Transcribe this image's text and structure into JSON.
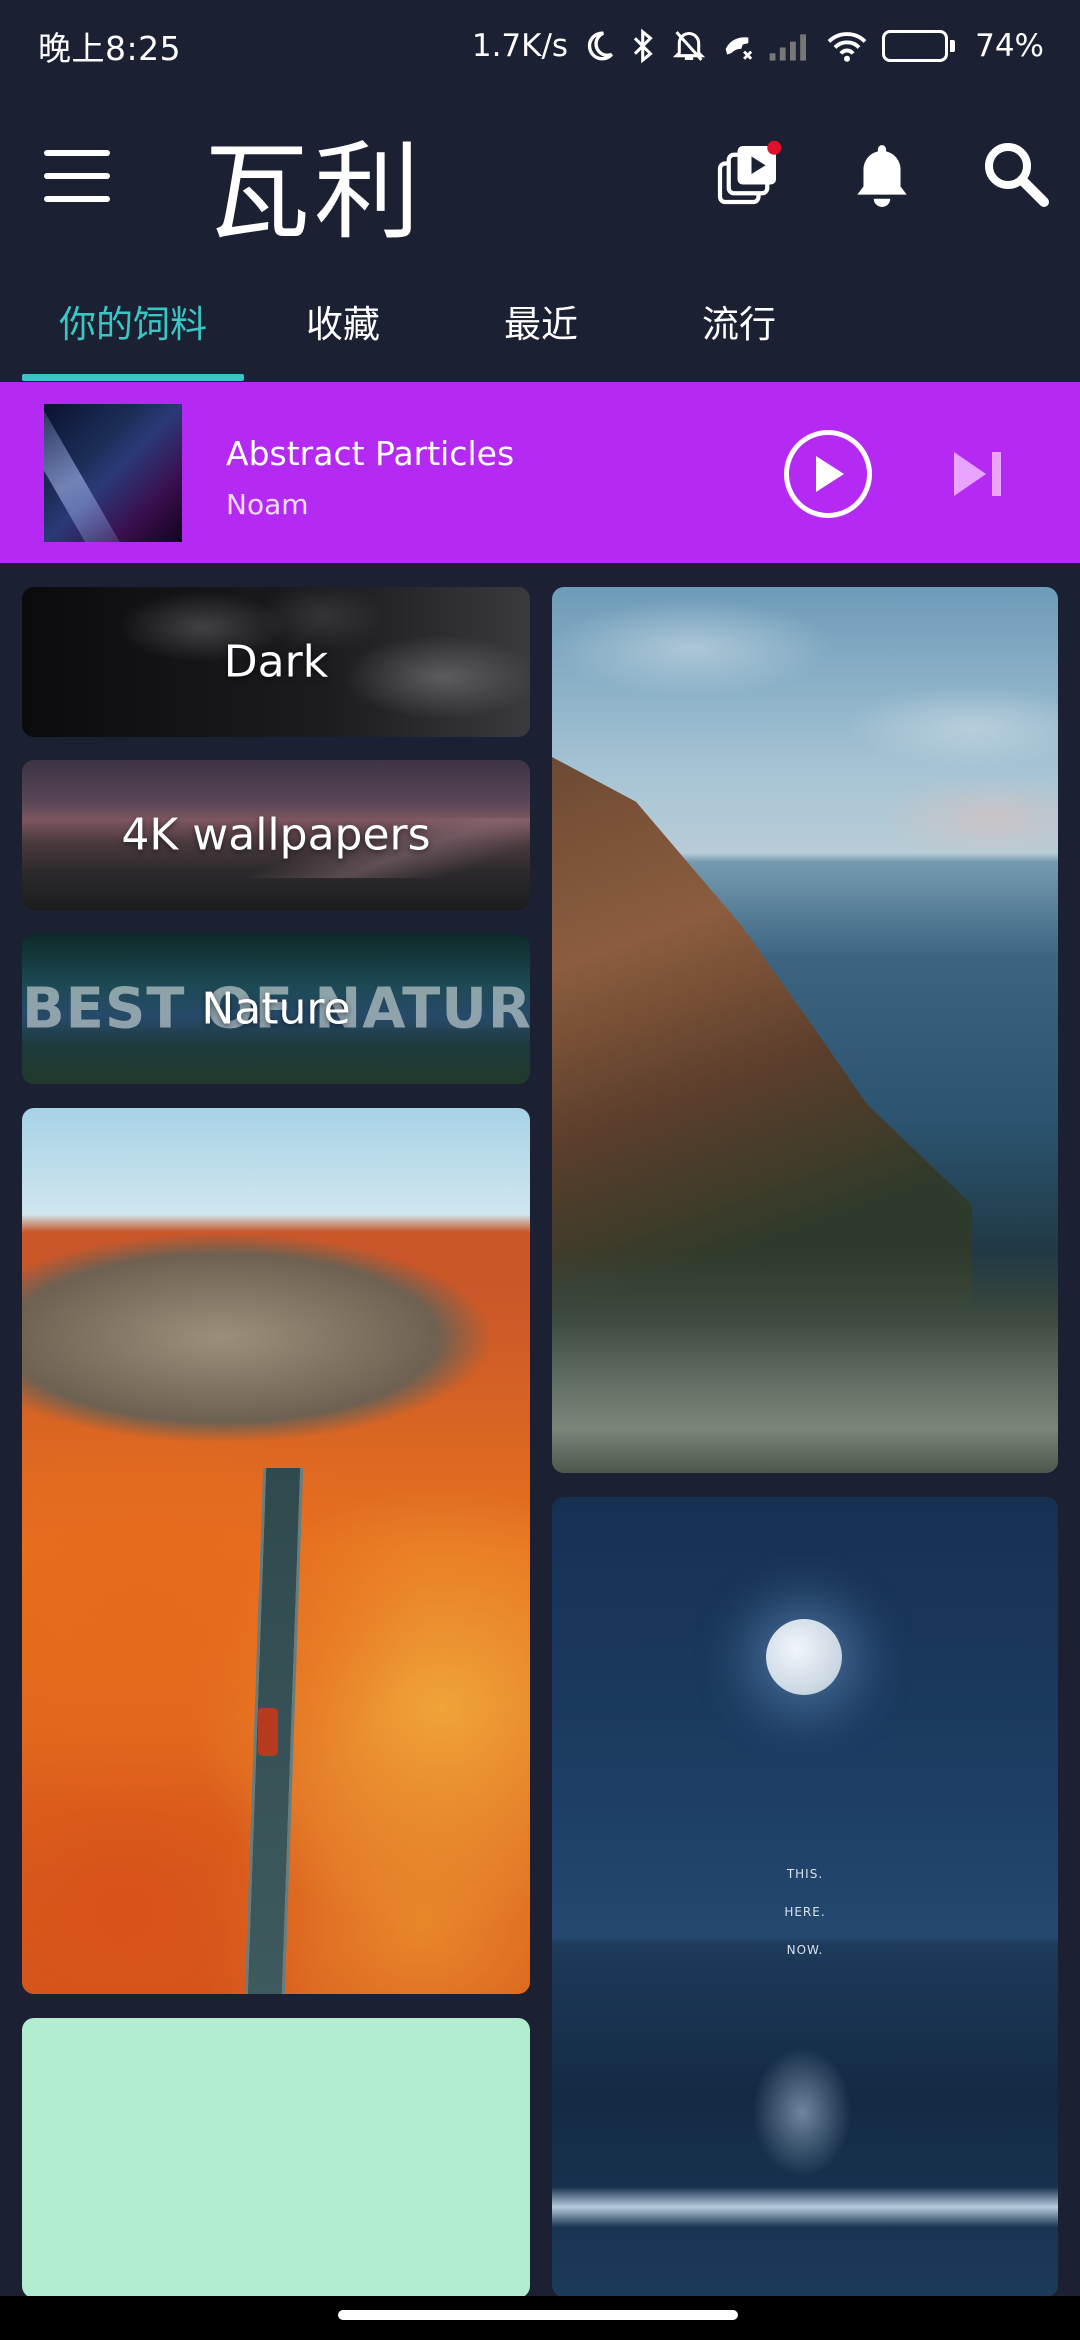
{
  "status_bar": {
    "time": "晚上8:25",
    "net_speed": "1.7K/s",
    "battery_pct": "74%",
    "battery_level": 0.74,
    "icons": [
      "moon-icon",
      "bluetooth-icon",
      "mute-icon",
      "call-icon",
      "signal-icon",
      "wifi-icon",
      "battery-icon"
    ]
  },
  "app": {
    "title": "瓦利"
  },
  "tabs": [
    {
      "label": "你的饲料",
      "active": true
    },
    {
      "label": "收藏",
      "active": false
    },
    {
      "label": "最近",
      "active": false
    },
    {
      "label": "流行",
      "active": false
    }
  ],
  "player": {
    "title": "Abstract Particles",
    "artist": "Noam"
  },
  "categories": {
    "dark": "Dark",
    "wallpapers_4k": "4K wallpapers",
    "nature": "Nature",
    "nature_overlay": "BEST OF NATURE"
  },
  "moon_card": {
    "lines": [
      "THIS.",
      "HERE.",
      "NOW."
    ]
  },
  "colors": {
    "background": "#1c2033",
    "accent": "#38c7c4",
    "player_bg": "#b52af2",
    "notification_dot": "#e0102a",
    "green_card": "#b2edcf"
  }
}
